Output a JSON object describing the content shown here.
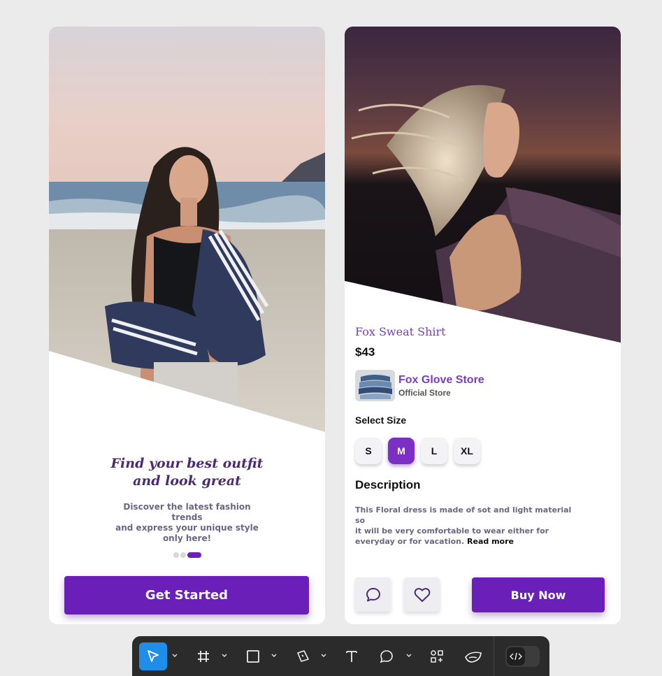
{
  "onboarding": {
    "title_line1": "Find your best outfit",
    "title_line2": "and look great",
    "subtitle_line1": "Discover the latest fashion trends",
    "subtitle_line2": "and express your unique style",
    "subtitle_line3": "only here!",
    "pager": {
      "pages": 3,
      "active": 3
    },
    "cta_label": "Get Started"
  },
  "product": {
    "name": "Fox Sweat Shirt",
    "price": "$43",
    "store_name": "Fox Glove Store",
    "store_type": "Official Store",
    "size_label": "Select Size",
    "sizes": [
      "S",
      "M",
      "L",
      "XL"
    ],
    "selected_size": "M",
    "description_title": "Description",
    "description_line1": "This Floral dress is made of sot and light material so",
    "description_line2": "it will be very comfortable to wear either for",
    "description_line3": "everyday or for vacation.",
    "read_more": "Read more",
    "buy_label": "Buy Now"
  },
  "toolbar": {
    "tools": [
      "move-tool",
      "frame-tool",
      "rectangle-tool",
      "pen-tool",
      "text-tool",
      "comment-tool",
      "components-tool",
      "actions-tool",
      "dev-mode-toggle"
    ],
    "active_tool": "move-tool"
  },
  "colors": {
    "accent": "#6a1fb8",
    "title": "#4b2a72",
    "toolbar": "#2b2b2b",
    "toolbar_active": "#1f8ee8"
  }
}
